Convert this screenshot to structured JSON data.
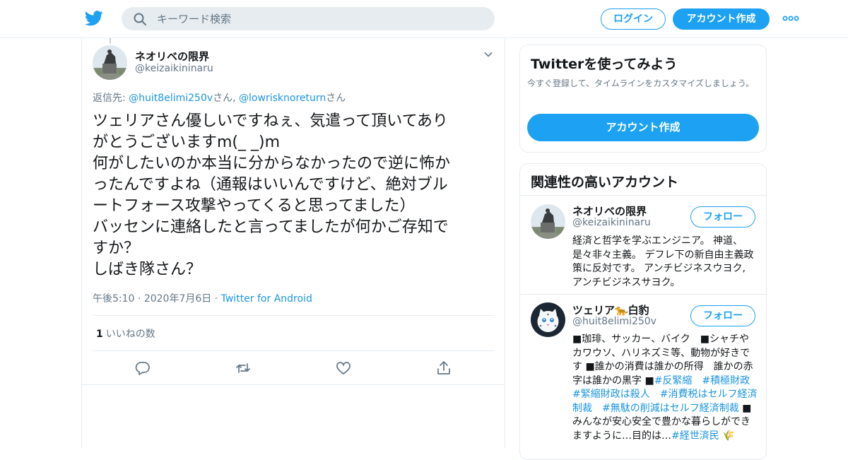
{
  "header": {
    "search_placeholder": "キーワード検索",
    "login_label": "ログイン",
    "signup_label": "アカウント作成",
    "accent": "#1da1f2"
  },
  "tweet": {
    "name": "ネオリベの限界",
    "handle": "@keizaikininaru",
    "reply_prefix": "返信先: ",
    "reply_to": [
      "@huit8elimi250v",
      "@lowrisknoreturn"
    ],
    "reply_suffix": "さん",
    "reply_sep": ", ",
    "text": "ツェリアさん優しいですねぇ、気遣って頂いてあり\nがとうございますm(_ _)m\n何がしたいのか本当に分からなかったので逆に怖か\nったんですよね（通報はいいんですけど、絶対ブル\nートフォース攻撃やってくると思ってました）\nバッセンに連絡したと言ってましたが何かご存知で\nすか？\nしばき隊さん？",
    "time": "午後5:10",
    "date": "2020年7月6日",
    "source": "Twitter for Android",
    "like_count": "1",
    "like_label": "いいねの数",
    "actions": [
      "reply-icon",
      "retweet-icon",
      "like-icon",
      "share-icon"
    ]
  },
  "sidebar": {
    "signup_card": {
      "title": "Twitterを使ってみよう",
      "desc": "今すぐ登録して、タイムラインをカスタマイズしましょう。",
      "button": "アカウント作成"
    },
    "related": {
      "title": "関連性の高いアカウント",
      "follow_label": "フォロー",
      "accounts": [
        {
          "name": "ネオリベの限界",
          "handle": "@keizaikininaru",
          "bio": "経済と哲学を学ぶエンジニア。 神道、是々非々主義。 デフレ下の新自由主義政策に反対です。 アンチビジネスウヨク, アンチビジネスサヨク。"
        },
        {
          "name": "ツェリア🐆白豹",
          "handle": "@huit8elimi250v",
          "bio_parts": [
            {
              "t": "■珈琲、サッカー、バイク　■シャチやカワウソ、ハリネズミ等、動物が好きです ■誰かの消費は誰かの所得　誰かの赤字は誰かの黒字 ■"
            },
            {
              "t": "#反緊縮",
              "tag": true
            },
            {
              "t": "　"
            },
            {
              "t": "#積極財政",
              "tag": true
            },
            {
              "t": "　"
            },
            {
              "t": "#緊縮財政は殺人",
              "tag": true
            },
            {
              "t": "　"
            },
            {
              "t": "#消費税はセルフ経済制裁",
              "tag": true
            },
            {
              "t": "　"
            },
            {
              "t": "#無駄の削減はセルフ経済制裁",
              "tag": true
            },
            {
              "t": " ■みんなが安心安全で豊かな暮らしができますように…目的は…"
            },
            {
              "t": "#経世済民",
              "tag": true
            },
            {
              "t": " 🌾"
            }
          ]
        }
      ]
    }
  }
}
